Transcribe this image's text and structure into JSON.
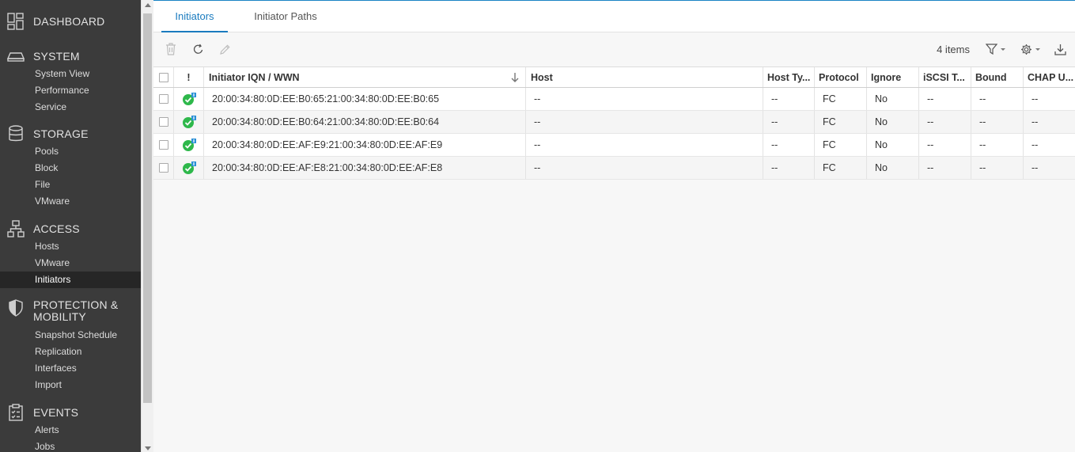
{
  "sidebar": {
    "sections": [
      {
        "icon": "dashboard-icon",
        "label": "DASHBOARD",
        "items": []
      },
      {
        "icon": "system-icon",
        "label": "SYSTEM",
        "items": [
          "System View",
          "Performance",
          "Service"
        ]
      },
      {
        "icon": "storage-icon",
        "label": "STORAGE",
        "items": [
          "Pools",
          "Block",
          "File",
          "VMware"
        ]
      },
      {
        "icon": "access-icon",
        "label": "ACCESS",
        "items": [
          "Hosts",
          "VMware",
          "Initiators"
        ]
      },
      {
        "icon": "shield-icon",
        "label_lines": [
          "PROTECTION &",
          "MOBILITY"
        ],
        "items": [
          "Snapshot Schedule",
          "Replication",
          "Interfaces",
          "Import"
        ]
      },
      {
        "icon": "events-icon",
        "label": "EVENTS",
        "items": [
          "Alerts",
          "Jobs"
        ]
      }
    ],
    "active_item": "Initiators"
  },
  "tabs": [
    {
      "label": "Initiators",
      "active": true
    },
    {
      "label": "Initiator Paths",
      "active": false
    }
  ],
  "toolbar": {
    "delete_icon": "trash-icon",
    "refresh_icon": "refresh-icon",
    "edit_icon": "pencil-icon",
    "item_count": "4 items",
    "filter_icon": "filter-icon",
    "settings_icon": "gear-icon",
    "export_icon": "download-icon"
  },
  "table": {
    "headers": {
      "status": "!",
      "iqn": "Initiator IQN / WWN",
      "host": "Host",
      "host_type": "Host Ty...",
      "protocol": "Protocol",
      "ignore": "Ignore",
      "iscsi": "iSCSI T...",
      "bound": "Bound",
      "chap": "CHAP U..."
    },
    "sort_column": "Initiator IQN / WWN",
    "rows": [
      {
        "status": "ok",
        "iqn": "20:00:34:80:0D:EE:B0:65:21:00:34:80:0D:EE:B0:65",
        "host": "--",
        "host_type": "--",
        "protocol": "FC",
        "ignore": "No",
        "iscsi": "--",
        "bound": "--",
        "chap": "--"
      },
      {
        "status": "ok",
        "iqn": "20:00:34:80:0D:EE:B0:64:21:00:34:80:0D:EE:B0:64",
        "host": "--",
        "host_type": "--",
        "protocol": "FC",
        "ignore": "No",
        "iscsi": "--",
        "bound": "--",
        "chap": "--"
      },
      {
        "status": "ok",
        "iqn": "20:00:34:80:0D:EE:AF:E9:21:00:34:80:0D:EE:AF:E9",
        "host": "--",
        "host_type": "--",
        "protocol": "FC",
        "ignore": "No",
        "iscsi": "--",
        "bound": "--",
        "chap": "--"
      },
      {
        "status": "ok",
        "iqn": "20:00:34:80:0D:EE:AF:E8:21:00:34:80:0D:EE:AF:E8",
        "host": "--",
        "host_type": "--",
        "protocol": "FC",
        "ignore": "No",
        "iscsi": "--",
        "bound": "--",
        "chap": "--"
      }
    ]
  },
  "colors": {
    "sidebar_bg": "#3b3b3b",
    "sidebar_active_bg": "#262626",
    "accent": "#1a7bbf",
    "status_ok": "#2eb84b",
    "status_badge": "#2a8fd6"
  }
}
